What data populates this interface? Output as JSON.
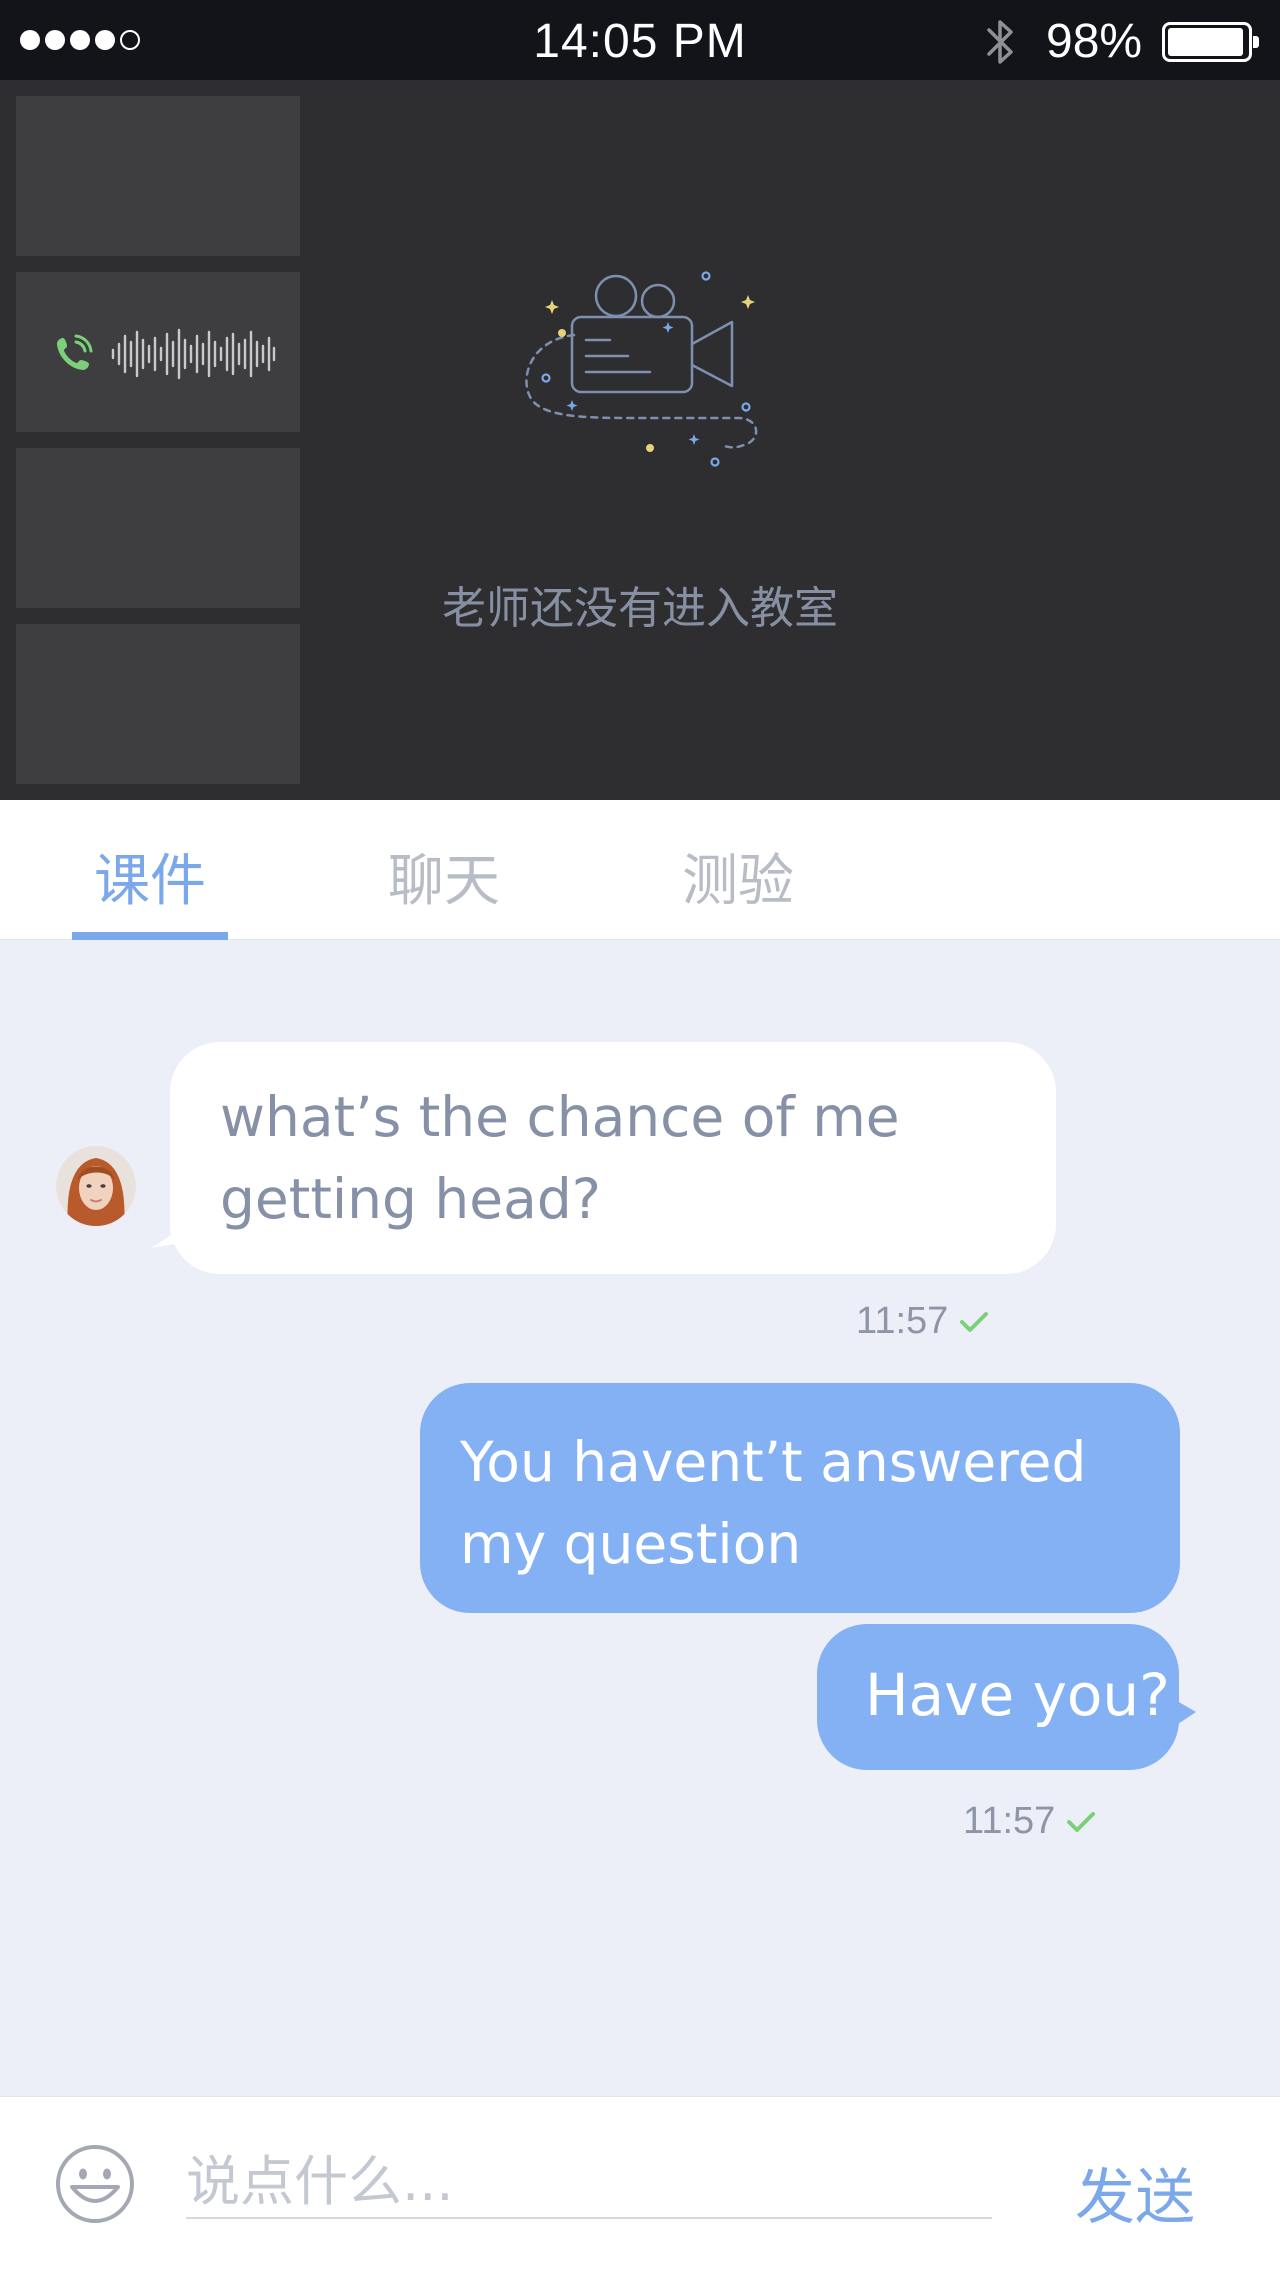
{
  "status_bar": {
    "time": "14:05 PM",
    "battery_percent": "98%",
    "signal_bars": 4,
    "signal_total": 5,
    "battery_level": 0.98
  },
  "video": {
    "empty_state_text": "老师还没有进入教室",
    "icons": {
      "call": "phone-call-icon",
      "audio": "audio-waveform-icon",
      "illustration": "video-camera-icon"
    }
  },
  "tabs": [
    {
      "label": "课件",
      "active": true
    },
    {
      "label": "聊天",
      "active": false
    },
    {
      "label": "测验",
      "active": false
    }
  ],
  "chat": {
    "messages": [
      {
        "direction": "incoming",
        "text": "what’s the chance of me getting head?",
        "time": "11:57"
      },
      {
        "direction": "outgoing",
        "text": "You havent’t answered my question"
      },
      {
        "direction": "outgoing",
        "text": "Have you?",
        "time": "11:57"
      }
    ]
  },
  "input": {
    "placeholder": "说点什么...",
    "value": "",
    "send_label": "发送",
    "emoji_icon": "smiley-icon"
  },
  "colors": {
    "accent": "#7aa8ea",
    "outgoing_bubble": "#84b1f4",
    "chat_background": "#eceff7",
    "video_background": "#2e2e30",
    "delivered_check": "#7dd07a"
  }
}
